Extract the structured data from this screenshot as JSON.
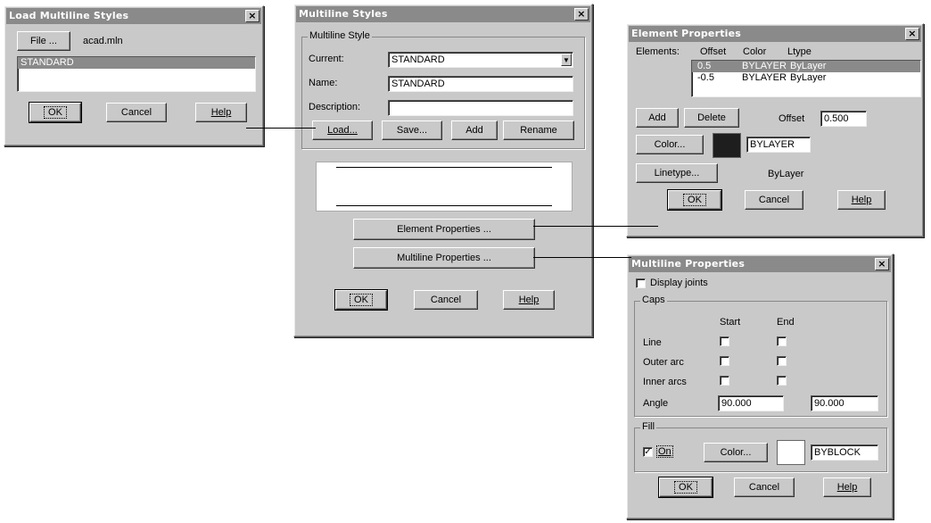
{
  "load_dialog": {
    "title": "Load Multiline Styles",
    "close": "×",
    "file_button": "File ...",
    "file_name": "acad.mln",
    "list_items": [
      "STANDARD"
    ],
    "ok": "OK",
    "cancel": "Cancel",
    "help": "Help"
  },
  "multiline_styles": {
    "title": "Multiline Styles",
    "close": "×",
    "group_title": "Multiline Style",
    "current_label": "Current:",
    "current_value": "STANDARD",
    "name_label": "Name:",
    "name_value": "STANDARD",
    "description_label": "Description:",
    "description_value": "",
    "load": "Load...",
    "save": "Save...",
    "add": "Add",
    "rename": "Rename",
    "element_properties": "Element Properties ...",
    "multiline_properties": "Multiline Properties ...",
    "ok": "OK",
    "cancel": "Cancel",
    "help": "Help"
  },
  "element_properties": {
    "title": "Element Properties",
    "close": "×",
    "elements_label": "Elements:",
    "col_offset": "Offset",
    "col_color": "Color",
    "col_ltype": "Ltype",
    "rows": [
      {
        "offset": "0.5",
        "color": "BYLAYER",
        "ltype": "ByLayer"
      },
      {
        "offset": "-0.5",
        "color": "BYLAYER",
        "ltype": "ByLayer"
      }
    ],
    "add": "Add",
    "delete": "Delete",
    "offset_label": "Offset",
    "offset_value": "0.500",
    "color_button": "Color...",
    "color_value": "BYLAYER",
    "linetype_button": "Linetype...",
    "linetype_value": "ByLayer",
    "ok": "OK",
    "cancel": "Cancel",
    "help": "Help"
  },
  "multiline_properties": {
    "title": "Multiline Properties",
    "close": "×",
    "display_joints": "Display joints",
    "caps_title": "Caps",
    "start_label": "Start",
    "end_label": "End",
    "line_label": "Line",
    "outer_arc_label": "Outer arc",
    "inner_arcs_label": "Inner arcs",
    "angle_label": "Angle",
    "angle_start": "90.000",
    "angle_end": "90.000",
    "fill_title": "Fill",
    "on_label": "On",
    "fill_checked": "✓",
    "color_button": "Color...",
    "color_value": "BYBLOCK",
    "ok": "OK",
    "cancel": "Cancel",
    "help": "Help"
  },
  "colors": {
    "dialog_bg": "#c9c9c9",
    "titlebar": "#8a8a8a",
    "element_color_swatch": "#1e1e1e",
    "fill_color_swatch": "#ffffff"
  }
}
